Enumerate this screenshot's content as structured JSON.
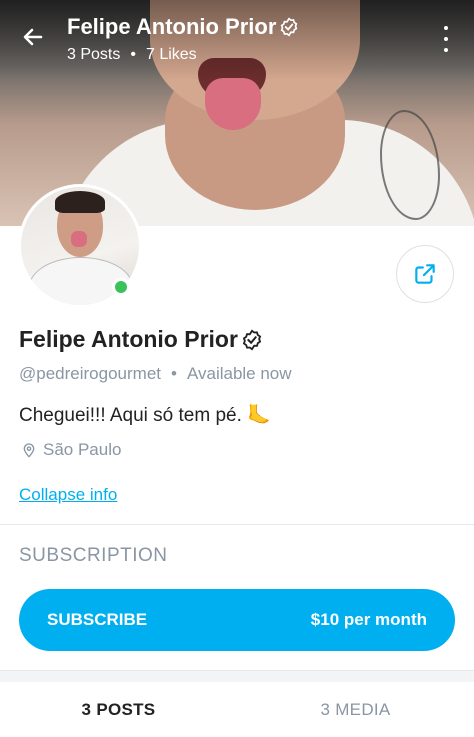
{
  "header": {
    "name": "Felipe Antonio Prior",
    "posts": "3 Posts",
    "likes": "7 Likes",
    "separator": "•"
  },
  "profile": {
    "name": "Felipe Antonio Prior",
    "handle": "@pedreirogourmet",
    "status_separator": "•",
    "status": "Available now",
    "bio": "Cheguei!!! Aqui só tem pé. 🦶",
    "location": "São Paulo",
    "collapse_label": "Collapse info"
  },
  "subscription": {
    "title": "SUBSCRIPTION",
    "button_label": "SUBSCRIBE",
    "price": "$10 per month"
  },
  "tabs": [
    {
      "label": "3 POSTS",
      "active": true
    },
    {
      "label": "3 MEDIA",
      "active": false
    }
  ],
  "colors": {
    "accent": "#00aff0",
    "muted": "#8a96a3",
    "online": "#3bc15c"
  },
  "icons": {
    "back": "arrow-left-icon",
    "more": "more-vertical-icon",
    "verified": "verified-badge-icon",
    "share": "share-icon",
    "location": "location-pin-icon"
  }
}
